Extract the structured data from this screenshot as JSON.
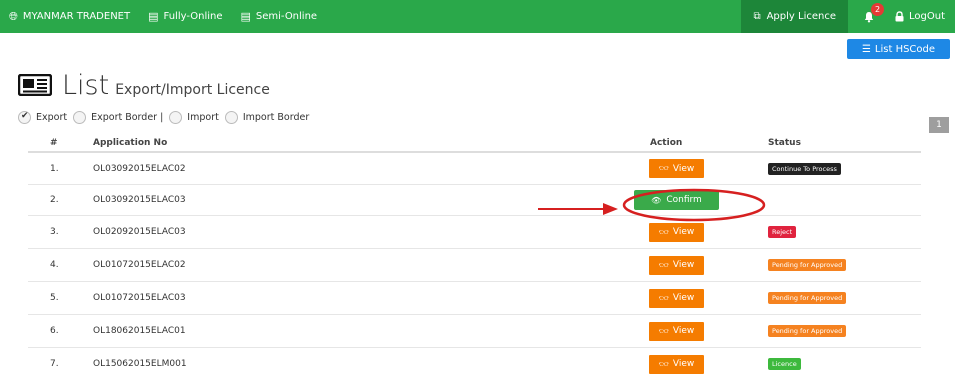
{
  "nav": {
    "brand": "MYANMAR TRADENET",
    "fully_online": "Fully-Online",
    "semi_online": "Semi-Online",
    "apply_licence": "Apply Licence",
    "notification_count": "2",
    "logout": "LogOut"
  },
  "toolbar": {
    "list_hscode": "List HSCode"
  },
  "page": {
    "title": "List",
    "subtitle": "Export/Import Licence"
  },
  "filters": {
    "options": [
      {
        "label": "Export",
        "selected": true
      },
      {
        "label": "Export Border |",
        "selected": false
      },
      {
        "label": "Import",
        "selected": false
      },
      {
        "label": "Import Border",
        "selected": false
      }
    ]
  },
  "pagination": {
    "current_page": "1"
  },
  "table": {
    "headers": {
      "num": "#",
      "app": "Application No",
      "action": "Action",
      "status": "Status"
    },
    "rows": [
      {
        "num": "1.",
        "app": "OL03092015ELAC02",
        "action": "View",
        "status": "Continue To Process",
        "status_color": "#222222"
      },
      {
        "num": "2.",
        "app": "OL03092015ELAC03",
        "action": "Confirm",
        "status": "",
        "status_color": ""
      },
      {
        "num": "3.",
        "app": "OL02092015ELAC03",
        "action": "View",
        "status": "Reject",
        "status_color": "#e0233e"
      },
      {
        "num": "4.",
        "app": "OL01072015ELAC02",
        "action": "View",
        "status": "Pending for Approved",
        "status_color": "#f58220"
      },
      {
        "num": "5.",
        "app": "OL01072015ELAC03",
        "action": "View",
        "status": "Pending for Approved",
        "status_color": "#f58220"
      },
      {
        "num": "6.",
        "app": "OL18062015ELAC01",
        "action": "View",
        "status": "Pending for Approved",
        "status_color": "#f58220"
      },
      {
        "num": "7.",
        "app": "OL15062015ELM001",
        "action": "View",
        "status": "Licence",
        "status_color": "#3db93d"
      }
    ]
  },
  "colors": {
    "nav_bg": "#2aa84a",
    "apply_bg": "#1d8639",
    "view_button": "#f57c00",
    "confirm_button": "#3aaa4a",
    "hscode_button": "#1e88e5",
    "annotation": "#d62020"
  }
}
